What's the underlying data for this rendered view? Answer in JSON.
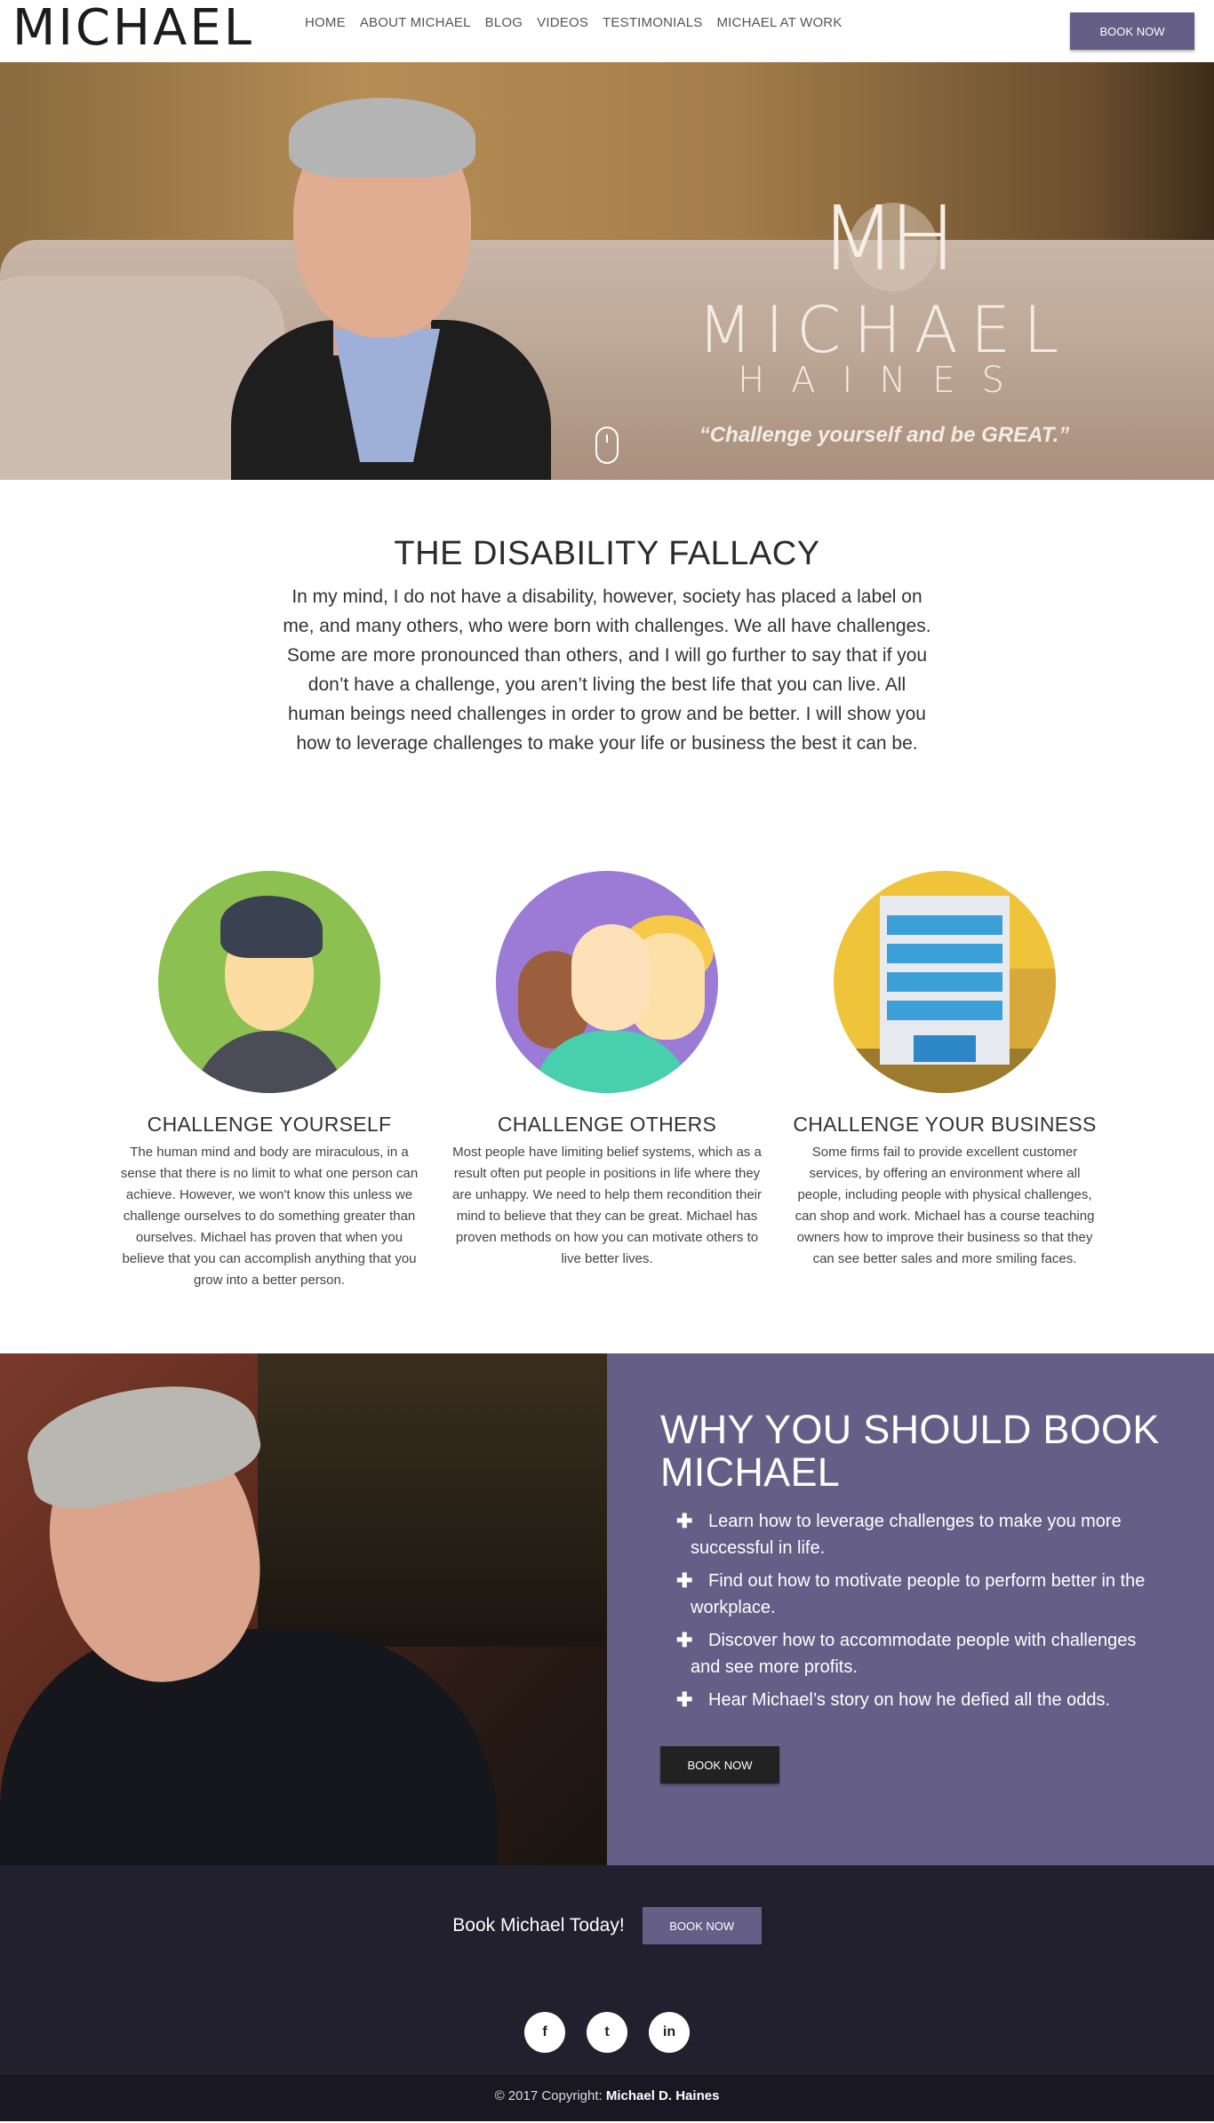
{
  "header": {
    "logo_text": "MICHAEL",
    "nav": [
      "HOME",
      "ABOUT MICHAEL",
      "BLOG",
      "VIDEOS",
      "TESTIMONIALS",
      "MICHAEL AT WORK"
    ],
    "book_button": "BOOK NOW"
  },
  "hero": {
    "monogram": "MH",
    "name": "MICHAEL",
    "surname": "HAINES",
    "quote": "“Challenge yourself and be GREAT.”"
  },
  "fallacy": {
    "title_light": "THE DISABILITY",
    "title_bold": "FALLACY",
    "body": "In my mind, I do not have a disability, however, society has placed a label on me, and many others, who were born with challenges. We all have challenges. Some are more pronounced than others, and I will go further to say that if you don’t have a challenge, you aren’t living the best life that you can live. All human beings need challenges in order to grow and be better. I will show you how to leverage challenges to make your life or business the best it can be."
  },
  "challenges": [
    {
      "icon": "person-avatar-icon",
      "title": "CHALLENGE YOURSELF",
      "body": "The human mind and body are miraculous, in a sense that there is no limit to what one person can achieve. However, we won't know this unless we challenge ourselves to do something greater than ourselves. Michael has proven that when you believe that you can accomplish anything that you grow into a better person."
    },
    {
      "icon": "group-avatar-icon",
      "title": "CHALLENGE OTHERS",
      "body": "Most people have limiting belief systems, which as a result often put people in positions in life where they are unhappy. We need to help them recondition their mind to believe that they can be great. Michael has proven methods on how you can motivate others to live better lives."
    },
    {
      "icon": "office-building-icon",
      "title": "CHALLENGE YOUR BUSINESS",
      "body": "Some firms fail to provide excellent customer services, by offering an environment where all people, including people with physical challenges, can shop and work. Michael has a course teaching owners how to improve their business so that they can see better sales and more smiling faces."
    }
  ],
  "why": {
    "title_light": "WHY YOU SHOULD BOOK",
    "title_bold": "MICHAEL",
    "items": [
      "Learn how to leverage challenges to make you more successful in life.",
      "Find out how to motivate people to perform better in the workplace.",
      "Discover how to accommodate people with challenges and see more profits.",
      "Hear Michael’s story on how he defied all the odds."
    ],
    "button": "BOOK NOW"
  },
  "footer": {
    "cta_text": "Book Michael Today!",
    "cta_button": "BOOK NOW",
    "socials": [
      {
        "icon": "facebook-icon",
        "glyph": "f"
      },
      {
        "icon": "twitter-icon",
        "glyph": "t"
      },
      {
        "icon": "linkedin-icon",
        "glyph": "in"
      }
    ],
    "copyright_prefix": "© 2017 Copyright:",
    "copyright_name": "Michael D. Haines"
  },
  "colors": {
    "accent": "#655e87",
    "footer_bg": "#221f2e",
    "copyright_bg": "#191722"
  }
}
